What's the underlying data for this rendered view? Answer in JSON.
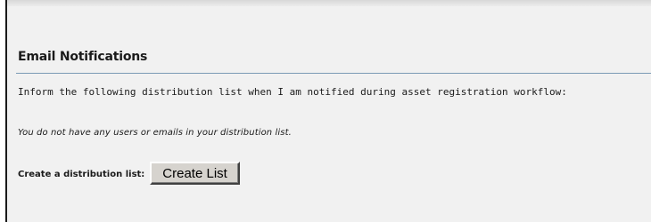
{
  "section": {
    "title": "Email Notifications",
    "description": "Inform the following distribution list when I am notified during asset registration workflow:",
    "empty_message": "You do not have any users or emails in your distribution list.",
    "create_label": "Create a distribution list:",
    "create_button_label": "Create List"
  },
  "colors": {
    "panel_background": "#f1f1f1",
    "rule": "#7a9ab5",
    "button_face": "#d6d3ce"
  }
}
